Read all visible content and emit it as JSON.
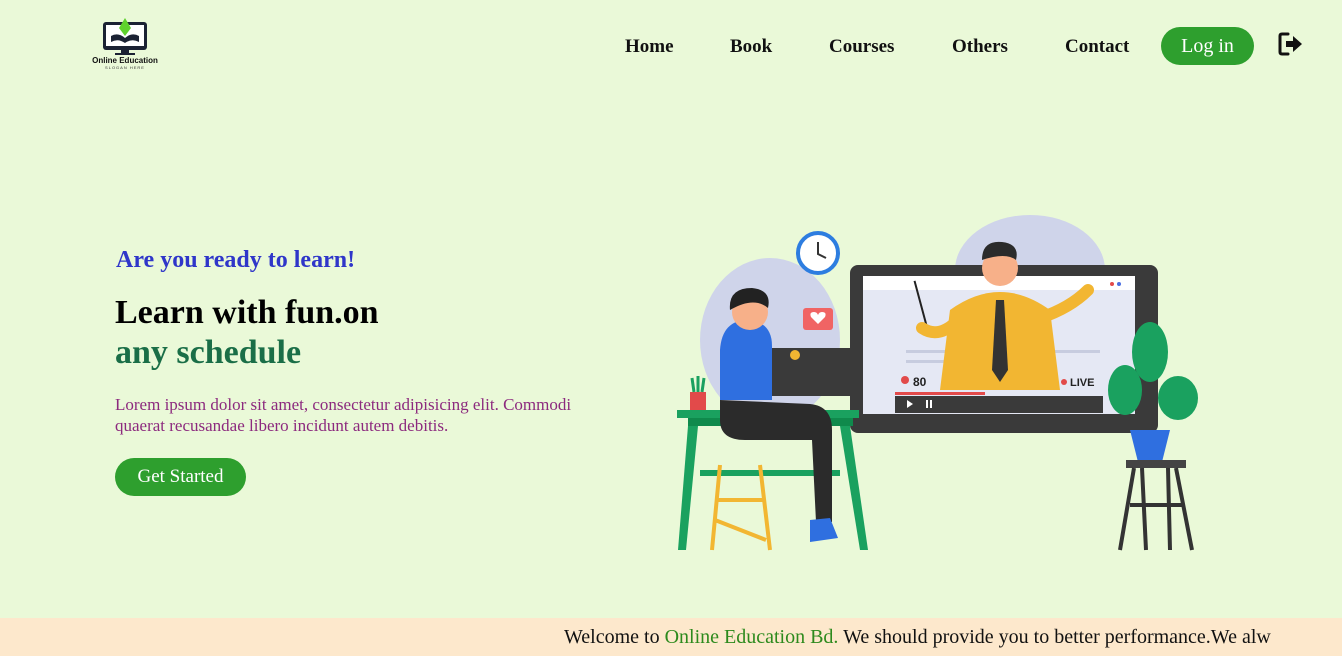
{
  "logo": {
    "caption": "Online Education",
    "slogan": "SLOGAN HERE"
  },
  "nav": {
    "items": [
      {
        "label": "Home"
      },
      {
        "label": "Book"
      },
      {
        "label": "Courses"
      },
      {
        "label": "Others"
      },
      {
        "label": "Contact"
      }
    ],
    "login_label": "Log in",
    "logout_icon": "sign-out-icon"
  },
  "hero": {
    "tagline": "Are you ready to learn!",
    "title_line1": "Learn with fun.on",
    "title_line2": "any schedule",
    "description": "Lorem ipsum dolor sit amet, consectetur adipisicing elit. Commodi quaerat recusandae libero incidunt autem debitis.",
    "cta_label": "Get Started",
    "illustration": {
      "viewer_count": "80",
      "live_label": "LIVE"
    }
  },
  "ticker": {
    "prefix": "Welcome to ",
    "brand": "Online Education Bd.",
    "suffix": " We should provide you to better performance.We alw"
  },
  "colors": {
    "background": "#eaf9d8",
    "accent_green": "#2e9f2e",
    "tagline_blue": "#2f36c9",
    "title_green": "#1a6e47",
    "description_purple": "#8c2a7e",
    "ticker_bg": "#fde8cc"
  }
}
